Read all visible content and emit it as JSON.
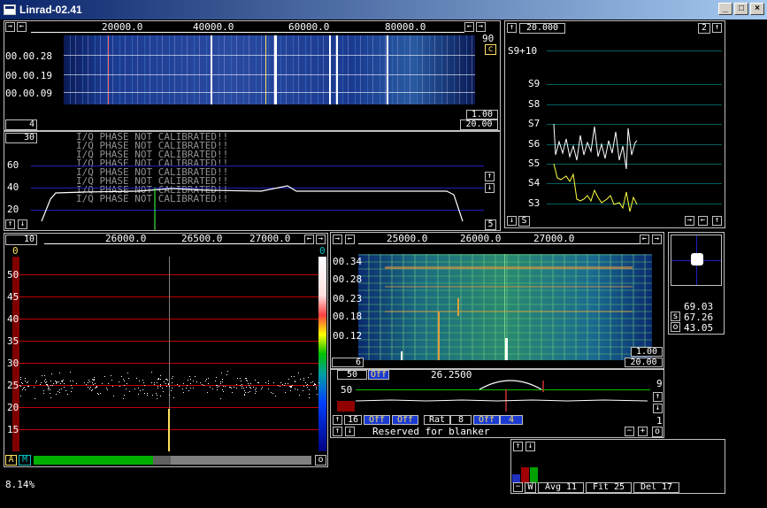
{
  "window": {
    "title": "Linrad-02.41",
    "min": "_",
    "max": "□",
    "close": "×"
  },
  "wide_wf": {
    "freq_ticks": [
      "20000.0",
      "40000.0",
      "60000.0",
      "80000.0"
    ],
    "times": [
      "00.00.28",
      "00.00.19",
      "00.00.09"
    ],
    "right_val": "90",
    "c_btn": "c",
    "left_num": "4",
    "gain1": "1.00",
    "gain2": "20.00"
  },
  "wide_spec": {
    "top_num": "30",
    "bottom_num": "5",
    "y_labels": [
      "60",
      "40",
      "20"
    ],
    "warning": "I/Q PHASE NOT CALIBRATED!!",
    "warning_count": 8
  },
  "smeter": {
    "top_val": "20.000",
    "top_right": "2",
    "labels": [
      "S9+10",
      "S9",
      "S8",
      "S7",
      "S6",
      "S5",
      "S4",
      "S3"
    ],
    "s_btn": "S"
  },
  "baseband": {
    "left_num": "10",
    "freq_ticks": [
      "26000.0",
      "26500.0",
      "27000.0"
    ],
    "corner_left": "0",
    "corner_right": "0",
    "y_labels": [
      "50",
      "45",
      "40",
      "35",
      "30",
      "25",
      "20",
      "15"
    ],
    "a_btn": "A",
    "m_btn": "M",
    "o_btn": "o",
    "percent": "8.14%"
  },
  "narrow_wf": {
    "freq_ticks": [
      "25000.0",
      "26000.0",
      "27000.0"
    ],
    "times": [
      "00.34",
      "00.28",
      "00.23",
      "00.18",
      "00.12"
    ],
    "left_num": "6",
    "gain1": "1.00",
    "gain2": "20.00"
  },
  "afc": {
    "left": "50",
    "off": "Off",
    "freq": "26.2500",
    "y_label": "50",
    "right_top": "9",
    "right_bottom": "1",
    "row2_num": "16",
    "row2_a": "Off",
    "row2_b": "Off",
    "rat": "Rat",
    "rat_val": "8",
    "row2_c": "Off",
    "row2_d": "4",
    "reserved": "Reserved for blanker",
    "o_btn": "o"
  },
  "constellation": {
    "s_lbl": "s",
    "o_lbl": "o",
    "vals": [
      "69.03",
      "67.26",
      "43.05"
    ]
  },
  "bottom_panel": {
    "w_btn": "W",
    "avg": "Avg 11",
    "fit": "Fit 25",
    "del": "Del 17"
  },
  "colors": {
    "grid_blue": "#2020c0",
    "grid_red": "#c00000",
    "smeter_grid": "#006060",
    "spectrum": "#ffffff",
    "accent_cyan": "#00c0c0"
  }
}
